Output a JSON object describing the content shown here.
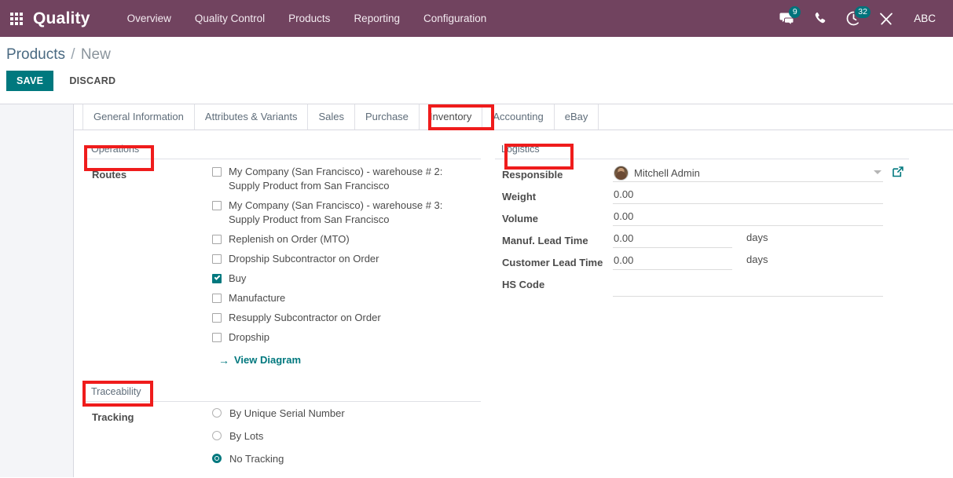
{
  "navbar": {
    "apps_icon": "apps-grid-icon",
    "brand": "Quality",
    "menu": [
      {
        "label": "Overview"
      },
      {
        "label": "Quality Control"
      },
      {
        "label": "Products"
      },
      {
        "label": "Reporting"
      },
      {
        "label": "Configuration"
      }
    ],
    "systray": {
      "messages_icon": "messages-icon",
      "messages_count": "9",
      "phone_icon": "phone-icon",
      "activities_icon": "activities-clock-icon",
      "activities_count": "32",
      "debug_icon": "debug-wrench-icon",
      "user_name": "ABC"
    },
    "accent_color": "#71435f"
  },
  "control_panel": {
    "breadcrumb_root": "Products",
    "breadcrumb_separator": "/",
    "breadcrumb_current": "New",
    "save_label": "SAVE",
    "discard_label": "DISCARD",
    "save_color": "#00787e"
  },
  "tabs": [
    {
      "label": "General Information",
      "active": false
    },
    {
      "label": "Attributes & Variants",
      "active": false
    },
    {
      "label": "Sales",
      "active": false
    },
    {
      "label": "Purchase",
      "active": false
    },
    {
      "label": "Inventory",
      "active": true
    },
    {
      "label": "Accounting",
      "active": false
    },
    {
      "label": "eBay",
      "active": false
    }
  ],
  "operations": {
    "title": "Operations",
    "routes_label": "Routes",
    "routes": [
      {
        "label": "My Company (San Francisco) - warehouse # 2: Supply Product from San Francisco",
        "checked": false
      },
      {
        "label": "My Company (San Francisco) - warehouse # 3: Supply Product from San Francisco",
        "checked": false
      },
      {
        "label": "Replenish on Order (MTO)",
        "checked": false
      },
      {
        "label": "Dropship Subcontractor on Order",
        "checked": false
      },
      {
        "label": "Buy",
        "checked": true
      },
      {
        "label": "Manufacture",
        "checked": false
      },
      {
        "label": "Resupply Subcontractor on Order",
        "checked": false
      },
      {
        "label": "Dropship",
        "checked": false
      }
    ],
    "view_diagram_label": "View Diagram",
    "view_diagram_arrow": "→"
  },
  "traceability": {
    "title": "Traceability",
    "tracking_label": "Tracking",
    "options": [
      {
        "label": "By Unique Serial Number",
        "selected": false
      },
      {
        "label": "By Lots",
        "selected": false
      },
      {
        "label": "No Tracking",
        "selected": true
      }
    ]
  },
  "logistics": {
    "title": "Logistics",
    "responsible": {
      "label": "Responsible",
      "value": "Mitchell Admin",
      "avatar_icon": "user-avatar",
      "caret_icon": "caret-down-icon",
      "external_link_icon": "external-link-icon"
    },
    "weight": {
      "label": "Weight",
      "value": "0.00"
    },
    "volume": {
      "label": "Volume",
      "value": "0.00"
    },
    "manuf_lead_time": {
      "label": "Manuf. Lead Time",
      "value": "0.00",
      "unit": "days"
    },
    "customer_lead_time": {
      "label": "Customer Lead Time",
      "value": "0.00",
      "unit": "days"
    },
    "hs_code": {
      "label": "HS Code",
      "value": ""
    }
  },
  "annotations": {
    "highlight_color": "#ef1c1c",
    "boxes": [
      "inventory-tab",
      "operations-title",
      "logistics-title",
      "traceability-title"
    ]
  }
}
